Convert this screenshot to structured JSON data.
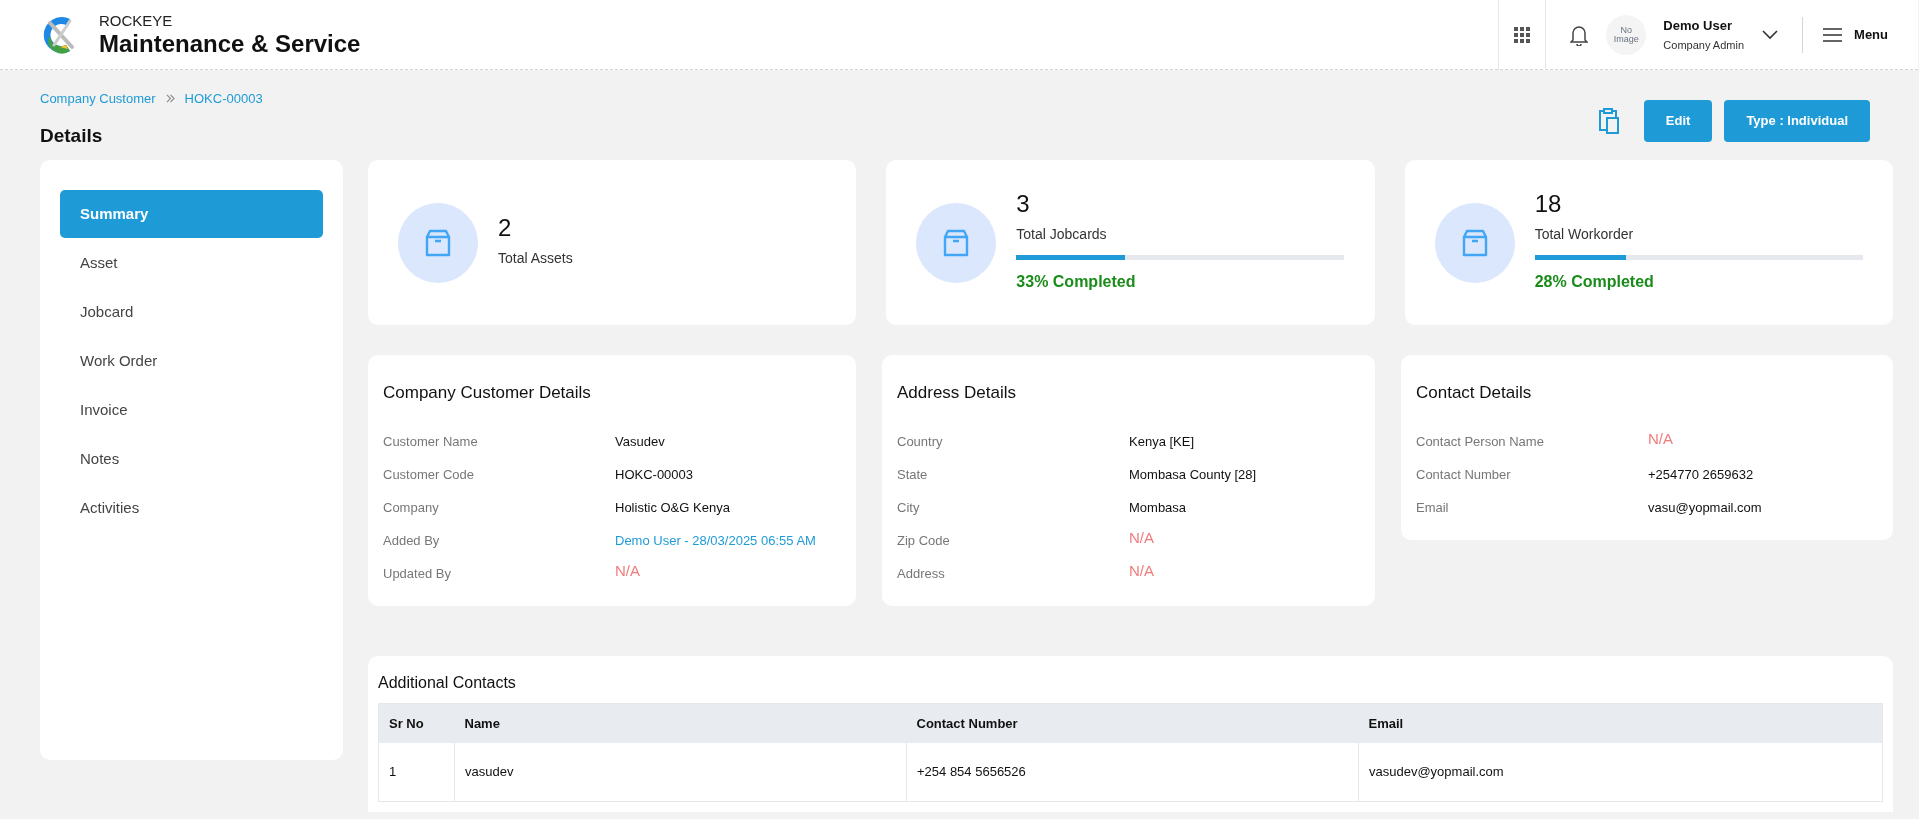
{
  "header": {
    "brand_top": "ROCKEYE",
    "brand_title": "Maintenance & Service",
    "avatar_text": "No Image",
    "user_name": "Demo User",
    "user_role": "Company Admin",
    "menu_label": "Menu"
  },
  "breadcrumbs": [
    "Company Customer",
    "HOKC-00003"
  ],
  "page_title": "Details",
  "actions": [
    {
      "label": "Edit"
    },
    {
      "label": "Type : Individual"
    }
  ],
  "sidebar": {
    "items": [
      {
        "label": "Summary",
        "selected": true
      },
      {
        "label": "Asset",
        "selected": false
      },
      {
        "label": "Jobcard",
        "selected": false
      },
      {
        "label": "Work Order",
        "selected": false
      },
      {
        "label": "Invoice",
        "selected": false
      },
      {
        "label": "Notes",
        "selected": false
      },
      {
        "label": "Activities",
        "selected": false
      }
    ]
  },
  "stats": [
    {
      "kind": "plain",
      "value": "2",
      "label": "Total Assets"
    },
    {
      "kind": "progress",
      "value": "3",
      "label": "Total Jobcards",
      "level": 0.33,
      "completed": "33% Completed"
    },
    {
      "kind": "progress",
      "value": "18",
      "label": "Total Workorder",
      "level": 0.28,
      "completed": "28% Completed"
    }
  ],
  "detail_cards": [
    {
      "title": "Company Customer Details",
      "fields": [
        {
          "label": "Customer Name",
          "value": "Vasudev",
          "kind": "text"
        },
        {
          "label": "Customer Code",
          "value": "HOKC-00003",
          "kind": "text"
        },
        {
          "label": "Company",
          "value": "Holistic O&G Kenya",
          "kind": "text"
        },
        {
          "label": "Added By",
          "value": "Demo User - 28/03/2025 06:55 AM",
          "kind": "link"
        },
        {
          "label": "Updated By",
          "value": "N/A",
          "kind": "empty"
        }
      ]
    },
    {
      "title": "Address Details",
      "fields": [
        {
          "label": "Country",
          "value": "Kenya [KE]",
          "kind": "text"
        },
        {
          "label": "State",
          "value": "Mombasa County [28]",
          "kind": "text"
        },
        {
          "label": "City",
          "value": "Mombasa",
          "kind": "text"
        },
        {
          "label": "Zip Code",
          "value": "N/A",
          "kind": "empty"
        },
        {
          "label": "Address",
          "value": "N/A",
          "kind": "empty"
        }
      ]
    },
    {
      "title": "Contact Details",
      "fields": [
        {
          "label": "Contact Person Name",
          "value": "N/A",
          "kind": "empty"
        },
        {
          "label": "Contact Number",
          "value": "+254770 2659632",
          "kind": "text"
        },
        {
          "label": "Email",
          "value": "vasu@yopmail.com",
          "kind": "text"
        }
      ]
    }
  ],
  "additional_contacts": {
    "title": "Additional Contacts",
    "columns": [
      "Sr No",
      "Name",
      "Contact Number",
      "Email"
    ],
    "rows": [
      [
        "1",
        "vasudev",
        "+254 854 5656526",
        "vasudev@yopmail.com"
      ]
    ]
  }
}
